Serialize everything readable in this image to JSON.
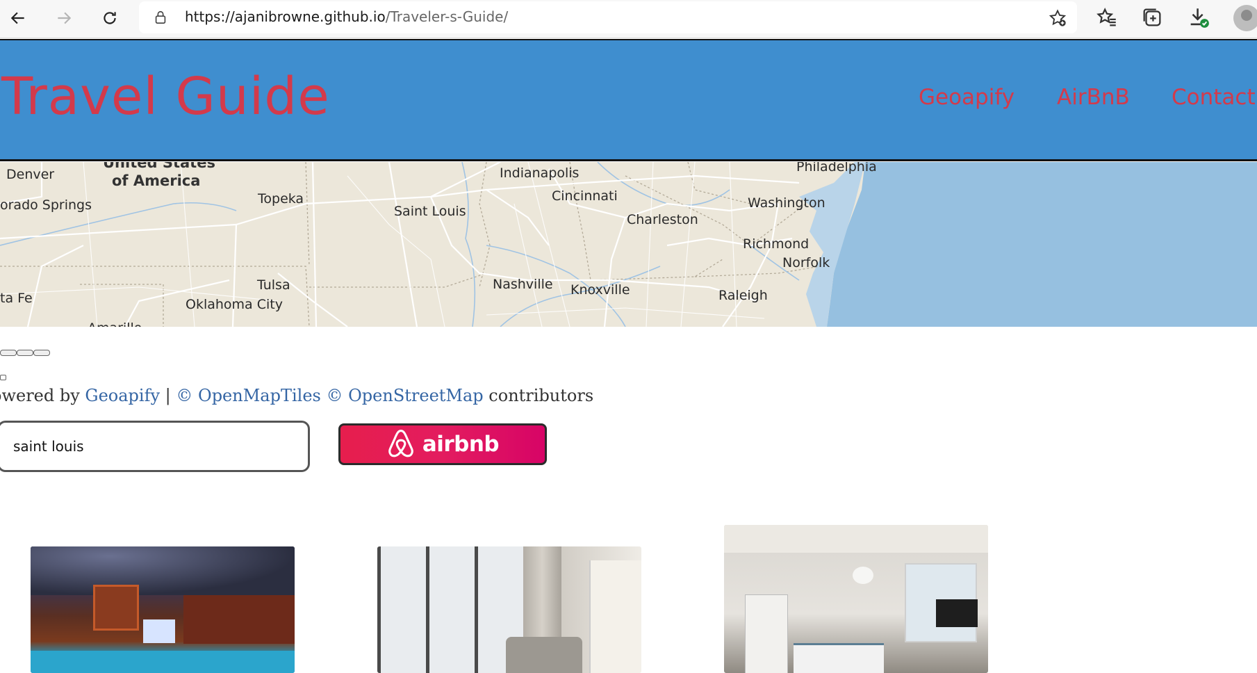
{
  "browser": {
    "url_host": "https://ajanibrowne.github.io",
    "url_path": "/Traveler-s-Guide/",
    "icons": [
      "back-arrow-icon",
      "forward-arrow-icon",
      "refresh-icon",
      "lock-icon",
      "add-favorite-icon",
      "favorites-icon",
      "collections-icon",
      "downloads-icon",
      "profile-icon"
    ]
  },
  "header": {
    "title": "Travel Guide",
    "nav": [
      "Geoapify",
      "AirBnB",
      "Contact U"
    ]
  },
  "map": {
    "labels": {
      "denver": "Denver",
      "usa1": "United States",
      "usa2": "of America",
      "colorado_springs": "orado Springs",
      "topeka": "Topeka",
      "indianapolis": "Indianapolis",
      "cincinnati": "Cincinnati",
      "saint_louis": "Saint Louis",
      "charleston": "Charleston",
      "washington": "Washington",
      "philadelphia": "Philadelphia",
      "richmond": "Richmond",
      "norfolk": "Norfolk",
      "tulsa": "Tulsa",
      "nashville": "Nashville",
      "knoxville": "Knoxville",
      "raleigh": "Raleigh",
      "santa_fe": "ta Fe",
      "oklahoma_city": "Oklahoma City",
      "amarillo": "Amarillo"
    },
    "colors": {
      "land": "#ece7da",
      "water": "#96c0e0",
      "roads": "#ffffff"
    }
  },
  "attribution": {
    "prefix": "owered by ",
    "geoapify": "Geoapify",
    "sep": " | ",
    "openmaptiles": "© OpenMapTiles",
    "osm": "© OpenStreetMap",
    "suffix": " contributors"
  },
  "search": {
    "value": "saint louis"
  },
  "airbnb_button": {
    "label": "airbnb"
  },
  "listings": [
    {
      "name": "listing-photo-pool-night"
    },
    {
      "name": "listing-photo-apartment-living-room"
    },
    {
      "name": "listing-photo-bedroom"
    }
  ],
  "colors": {
    "header_bg": "#3f8ecf",
    "accent": "#d33a4b",
    "airbnb": "#e61e4d",
    "link": "#3465a4"
  }
}
